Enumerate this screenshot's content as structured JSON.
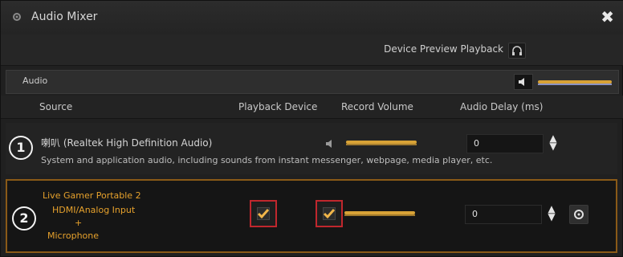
{
  "window": {
    "title": "Audio Mixer",
    "close_glyph": "✖",
    "app_icon": "gear-icon"
  },
  "preview": {
    "label": "Device Preview Playback",
    "icon": "headphones-icon"
  },
  "audio": {
    "label": "Audio",
    "icon": "speaker-icon",
    "master_volume": 1.0
  },
  "columns": {
    "source": "Source",
    "playback": "Playback Device",
    "record": "Record Volume",
    "delay": "Audio Delay (ms)"
  },
  "rows": [
    {
      "badge": "1",
      "name": "喇叭 (Realtek High Definition Audio)",
      "description": "System and application audio, including sounds from instant messenger, webpage, media player, etc.",
      "volume": 1.0,
      "delay": "0"
    },
    {
      "badge": "2",
      "name_line1": "Live Gamer Portable 2",
      "name_line2": "HDMI/Analog Input",
      "name_line3": "+",
      "name_line4": "Microphone",
      "playback_checked": true,
      "record_checked": true,
      "volume": 1.0,
      "delay": "0",
      "accent": "#e6a12c",
      "highlight_border": "#8a5a17",
      "checkbox_border": "#c0272d"
    }
  ]
}
